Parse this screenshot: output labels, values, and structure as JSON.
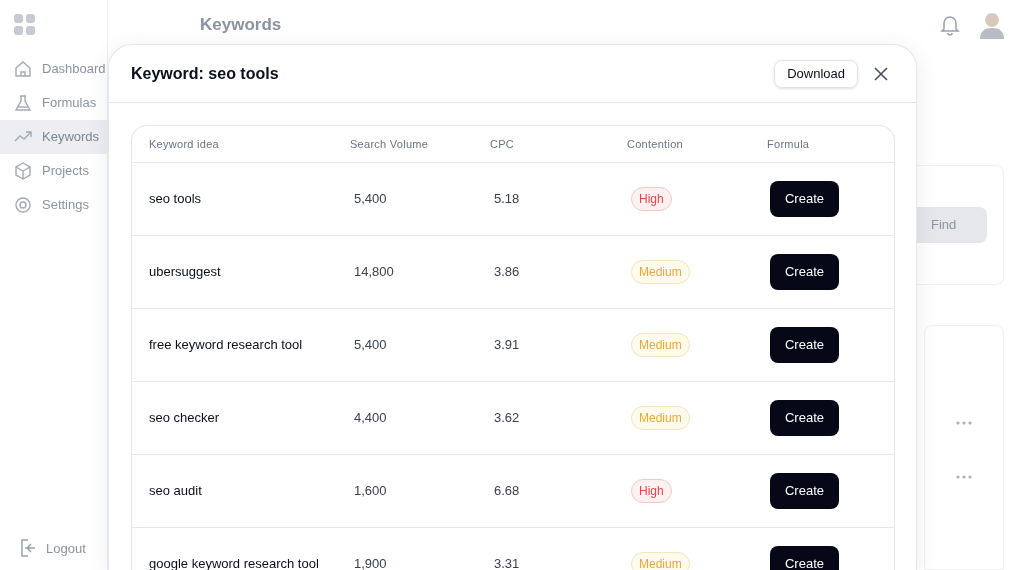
{
  "page": {
    "title": "Keywords",
    "find_button": "Find"
  },
  "sidebar": {
    "items": [
      {
        "label": "Dashboard",
        "selected": false
      },
      {
        "label": "Formulas",
        "selected": false
      },
      {
        "label": "Keywords",
        "selected": true
      },
      {
        "label": "Projects",
        "selected": false
      },
      {
        "label": "Settings",
        "selected": false
      }
    ],
    "logout": "Logout"
  },
  "modal": {
    "title": "Keyword: seo tools",
    "download_button": "Download",
    "table": {
      "columns": [
        "Keyword idea",
        "Search Volume",
        "CPC",
        "Contention",
        "Formula"
      ],
      "rows": [
        {
          "keyword": "seo tools",
          "volume": "5,400",
          "cpc": "5.18",
          "contention": {
            "label": "High",
            "kind": "high"
          },
          "action": "Create"
        },
        {
          "keyword": "ubersuggest",
          "volume": "14,800",
          "cpc": "3.86",
          "contention": {
            "label": "Medium",
            "kind": "medium"
          },
          "action": "Create"
        },
        {
          "keyword": "free keyword research tool",
          "volume": "5,400",
          "cpc": "3.91",
          "contention": {
            "label": "Medium",
            "kind": "medium"
          },
          "action": "Create"
        },
        {
          "keyword": "seo checker",
          "volume": "4,400",
          "cpc": "3.62",
          "contention": {
            "label": "Medium",
            "kind": "medium"
          },
          "action": "Create"
        },
        {
          "keyword": "seo audit",
          "volume": "1,600",
          "cpc": "6.68",
          "contention": {
            "label": "High",
            "kind": "high"
          },
          "action": "Create"
        },
        {
          "keyword": "google keyword research tool",
          "volume": "1,900",
          "cpc": "3.31",
          "contention": {
            "label": "Medium",
            "kind": "medium"
          },
          "action": "Create"
        }
      ]
    }
  }
}
